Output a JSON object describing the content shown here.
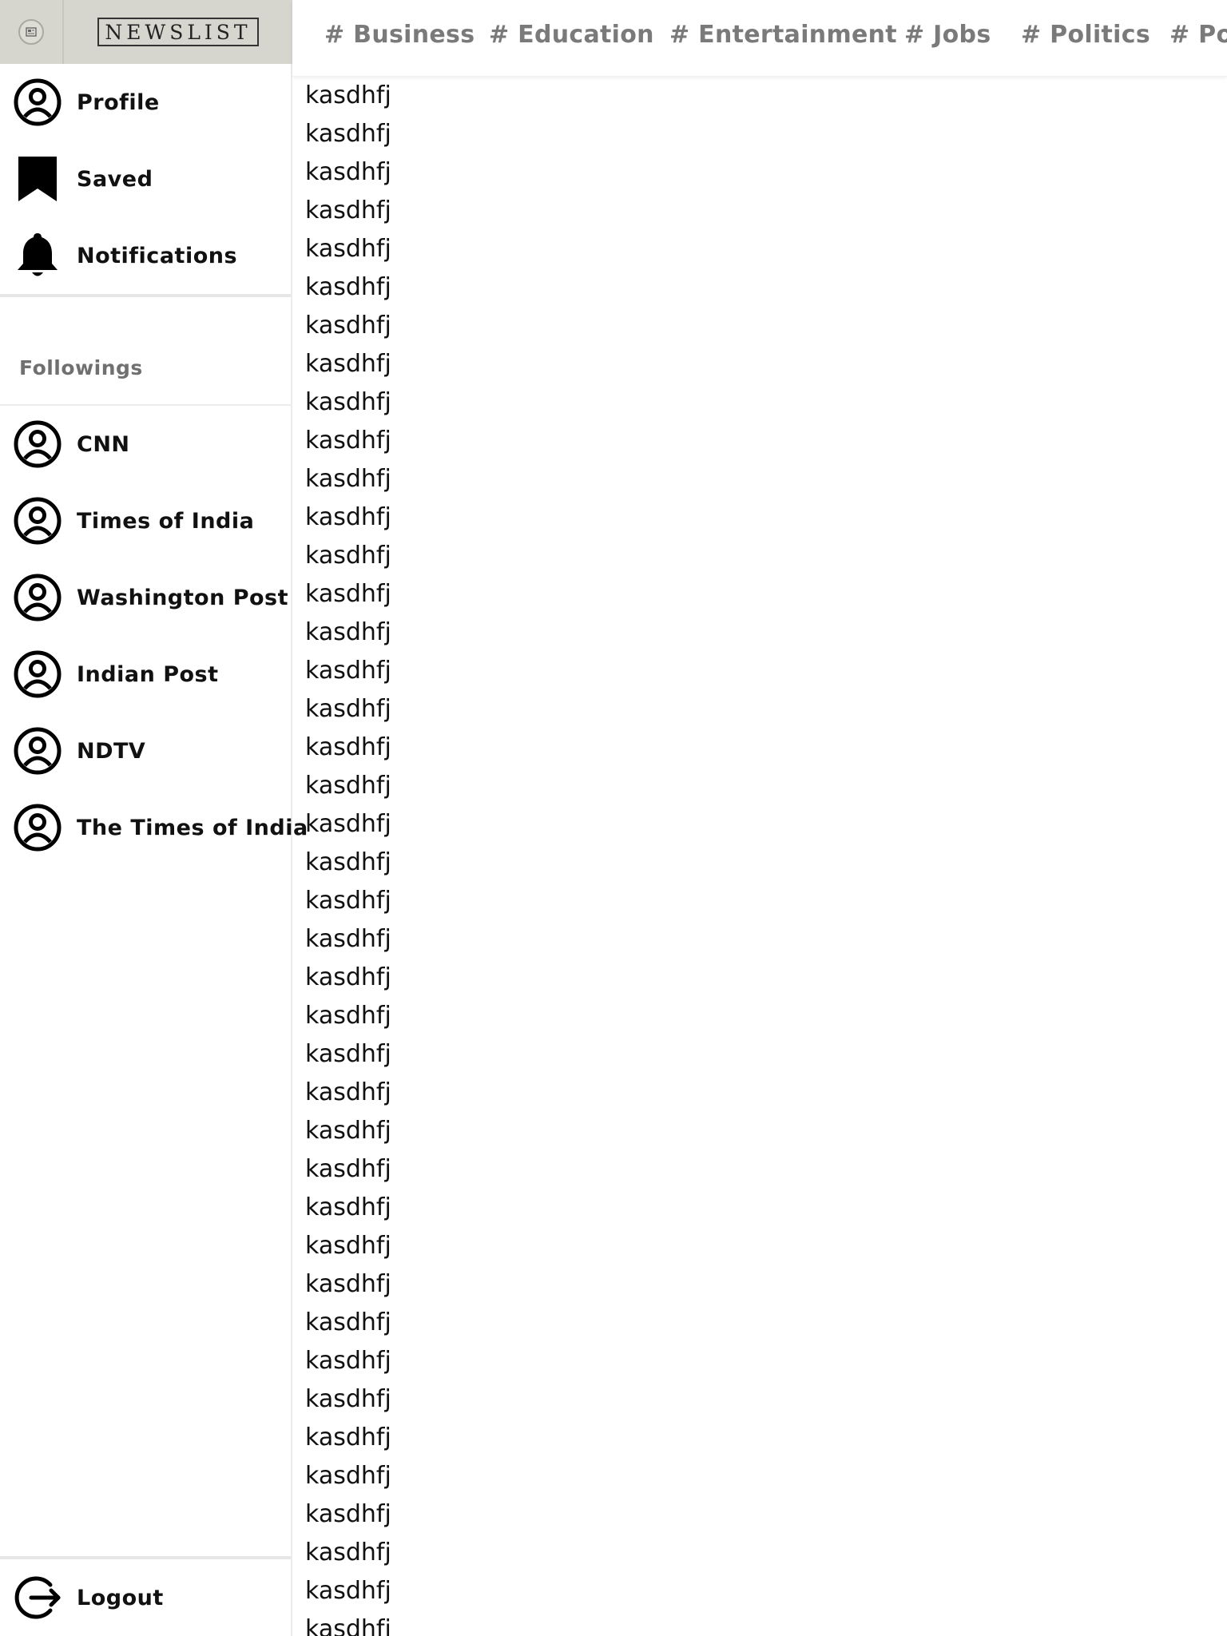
{
  "brand": {
    "name": "NEWSLIST"
  },
  "sidebar": {
    "menu": [
      {
        "label": "Profile",
        "icon": "profile-icon"
      },
      {
        "label": "Saved",
        "icon": "bookmark-icon"
      },
      {
        "label": "Notifications",
        "icon": "bell-icon"
      }
    ],
    "followings_title": "Followings",
    "followings": [
      {
        "label": "CNN",
        "icon": "user-circle-icon"
      },
      {
        "label": "Times of India",
        "icon": "user-circle-icon"
      },
      {
        "label": "Washington Post",
        "icon": "user-circle-icon"
      },
      {
        "label": "Indian Post",
        "icon": "user-circle-icon"
      },
      {
        "label": "NDTV",
        "icon": "user-circle-icon"
      },
      {
        "label": "The Times of India",
        "icon": "user-circle-icon"
      }
    ],
    "logout_label": "Logout"
  },
  "tabs": [
    "# Business",
    "# Education",
    "# Entertainment",
    "# Jobs",
    "# Politics",
    "# Po"
  ],
  "feed": {
    "items": [
      "kasdhfj",
      "kasdhfj",
      "kasdhfj",
      "kasdhfj",
      "kasdhfj",
      "kasdhfj",
      "kasdhfj",
      "kasdhfj",
      "kasdhfj",
      "kasdhfj",
      "kasdhfj",
      "kasdhfj",
      "kasdhfj",
      "kasdhfj",
      "kasdhfj",
      "kasdhfj",
      "kasdhfj",
      "kasdhfj",
      "kasdhfj",
      "kasdhfj",
      "kasdhfj",
      "kasdhfj",
      "kasdhfj",
      "kasdhfj",
      "kasdhfj",
      "kasdhfj",
      "kasdhfj",
      "kasdhfj",
      "kasdhfj",
      "kasdhfj",
      "kasdhfj",
      "kasdhfj",
      "kasdhfj",
      "kasdhfj",
      "kasdhfj",
      "kasdhfj",
      "kasdhfj",
      "kasdhfj",
      "kasdhfj",
      "kasdhfj",
      "kasdhfj"
    ]
  },
  "colors": {
    "logo_bar": "#d6d6cf",
    "tab_text": "#7a7a7a",
    "section_title": "#707070",
    "divider": "#e6e6e6"
  }
}
